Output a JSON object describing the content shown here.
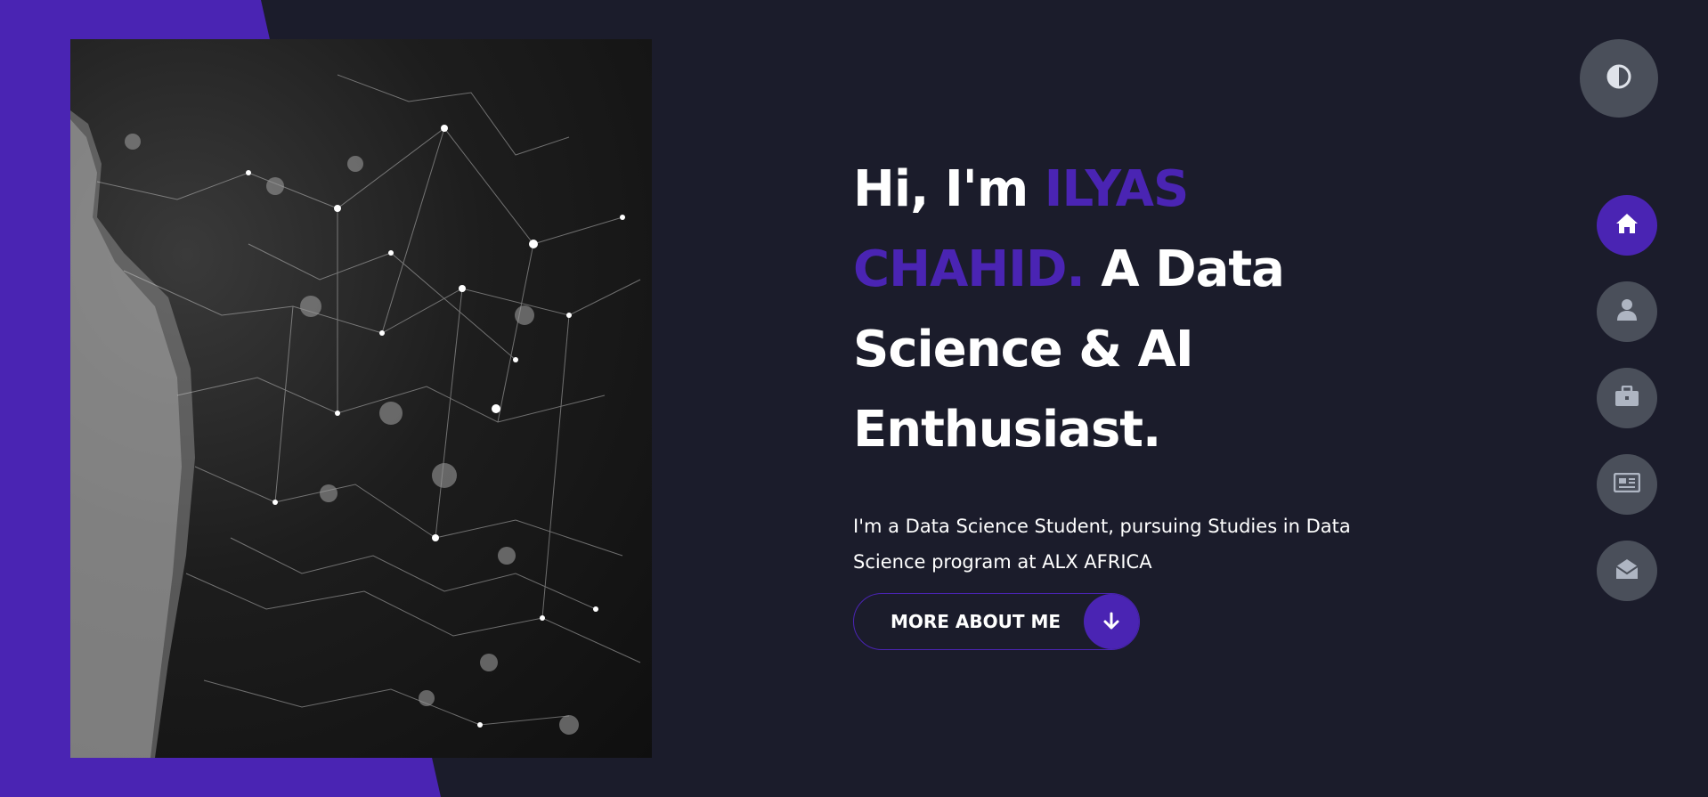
{
  "hero": {
    "greeting": "Hi, I'm ",
    "name": "ILYAS CHAHID.",
    "title_rest": " A Data Science & AI Enthusiast.",
    "tagline": "I'm a Data Science Student, pursuing Studies in Data Science program at ALX AFRICA"
  },
  "cta": {
    "label": "MORE ABOUT ME",
    "icon": "arrow-down-icon"
  },
  "theme_toggle": {
    "icon": "contrast-icon"
  },
  "nav": {
    "items": [
      {
        "icon": "home-icon",
        "active": true
      },
      {
        "icon": "user-icon",
        "active": false
      },
      {
        "icon": "briefcase-icon",
        "active": false
      },
      {
        "icon": "newspaper-icon",
        "active": false
      },
      {
        "icon": "envelope-open-icon",
        "active": false
      }
    ]
  },
  "colors": {
    "background": "#1b1c2b",
    "accent": "#4a24b3",
    "button_gray": "#4a4f5a",
    "text": "#ffffff"
  }
}
